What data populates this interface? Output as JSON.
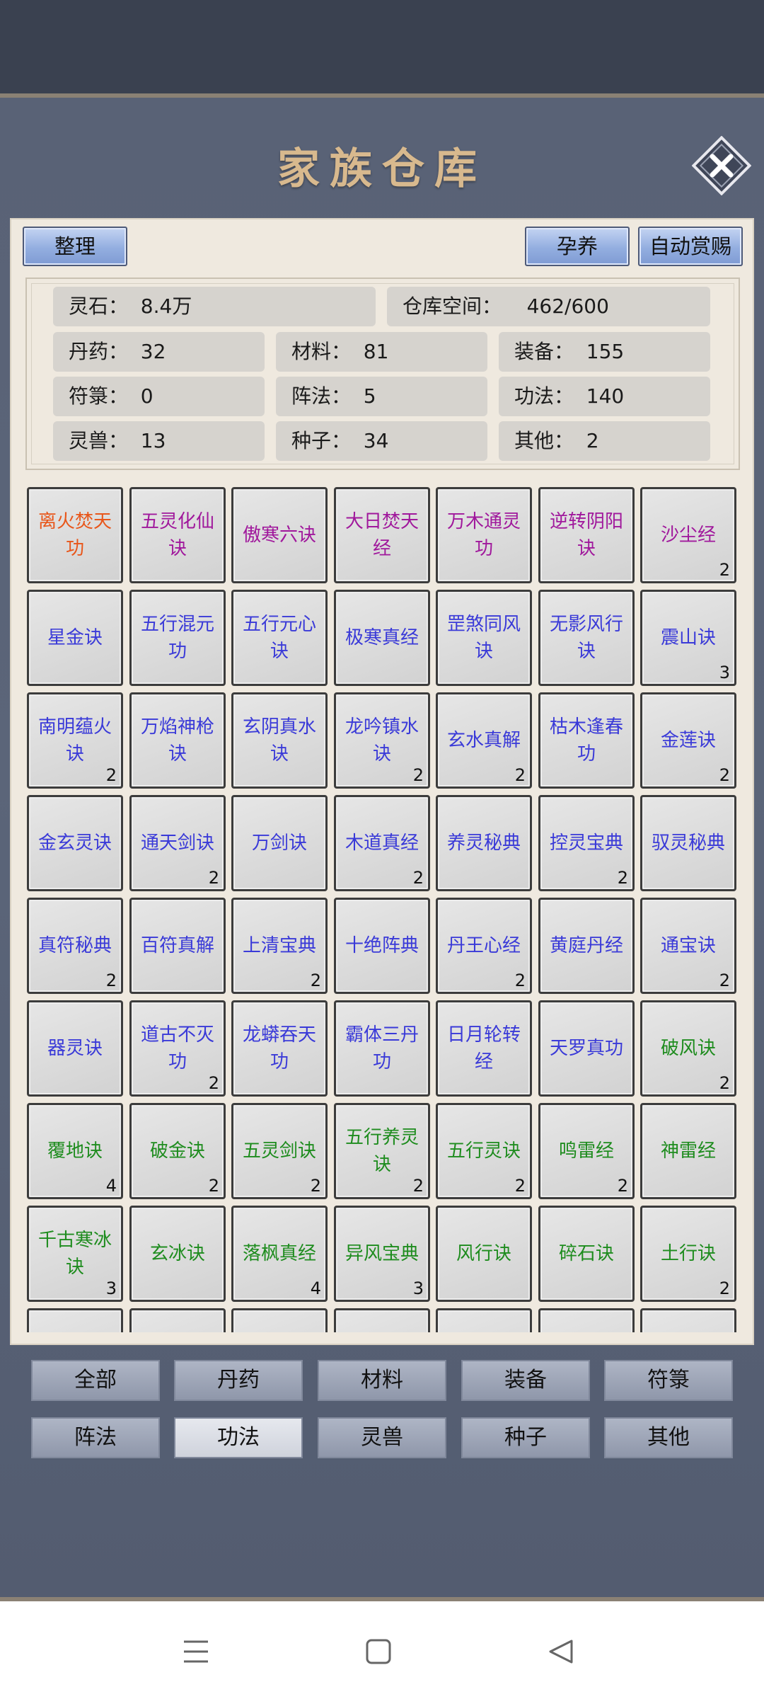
{
  "title": "家族仓库",
  "buttons": {
    "sort": "整理",
    "breed": "孕养",
    "auto_reward": "自动赏赐"
  },
  "stats": {
    "spirit_stone": "灵石：  8.4万",
    "storage_space": "仓库空间：    462/600",
    "pills": "丹药：  32",
    "materials": "材料：  81",
    "equipment": "装备：  155",
    "talismans": "符箓：  0",
    "formations": "阵法：  5",
    "techniques": "功法：  140",
    "beasts": "灵兽：  13",
    "seeds": "种子：  34",
    "others": "其他：  2"
  },
  "colors": {
    "orange": "#e8561a",
    "purple": "#a0189c",
    "blue": "#3a3ad8",
    "green": "#1e8c1e"
  },
  "items": [
    {
      "name": "离火焚天功",
      "color": "orange",
      "count": ""
    },
    {
      "name": "五灵化仙诀",
      "color": "purple",
      "count": ""
    },
    {
      "name": "傲寒六诀",
      "color": "purple",
      "count": ""
    },
    {
      "name": "大日焚天经",
      "color": "purple",
      "count": ""
    },
    {
      "name": "万木通灵功",
      "color": "purple",
      "count": ""
    },
    {
      "name": "逆转阴阳诀",
      "color": "purple",
      "count": ""
    },
    {
      "name": "沙尘经",
      "color": "purple",
      "count": "2"
    },
    {
      "name": "星金诀",
      "color": "blue",
      "count": ""
    },
    {
      "name": "五行混元功",
      "color": "blue",
      "count": ""
    },
    {
      "name": "五行元心诀",
      "color": "blue",
      "count": ""
    },
    {
      "name": "极寒真经",
      "color": "blue",
      "count": ""
    },
    {
      "name": "罡煞同风诀",
      "color": "blue",
      "count": ""
    },
    {
      "name": "无影风行诀",
      "color": "blue",
      "count": ""
    },
    {
      "name": "震山诀",
      "color": "blue",
      "count": "3"
    },
    {
      "name": "南明蕴火诀",
      "color": "blue",
      "count": "2"
    },
    {
      "name": "万焰神枪诀",
      "color": "blue",
      "count": ""
    },
    {
      "name": "玄阴真水诀",
      "color": "blue",
      "count": ""
    },
    {
      "name": "龙吟镇水诀",
      "color": "blue",
      "count": "2"
    },
    {
      "name": "玄水真解",
      "color": "blue",
      "count": "2"
    },
    {
      "name": "枯木逢春功",
      "color": "blue",
      "count": ""
    },
    {
      "name": "金莲诀",
      "color": "blue",
      "count": "2"
    },
    {
      "name": "金玄灵诀",
      "color": "blue",
      "count": ""
    },
    {
      "name": "通天剑诀",
      "color": "blue",
      "count": "2"
    },
    {
      "name": "万剑诀",
      "color": "blue",
      "count": ""
    },
    {
      "name": "木道真经",
      "color": "blue",
      "count": "2"
    },
    {
      "name": "养灵秘典",
      "color": "blue",
      "count": ""
    },
    {
      "name": "控灵宝典",
      "color": "blue",
      "count": "2"
    },
    {
      "name": "驭灵秘典",
      "color": "blue",
      "count": ""
    },
    {
      "name": "真符秘典",
      "color": "blue",
      "count": "2"
    },
    {
      "name": "百符真解",
      "color": "blue",
      "count": ""
    },
    {
      "name": "上清宝典",
      "color": "blue",
      "count": "2"
    },
    {
      "name": "十绝阵典",
      "color": "blue",
      "count": ""
    },
    {
      "name": "丹王心经",
      "color": "blue",
      "count": "2"
    },
    {
      "name": "黄庭丹经",
      "color": "blue",
      "count": ""
    },
    {
      "name": "通宝诀",
      "color": "blue",
      "count": "2"
    },
    {
      "name": "器灵诀",
      "color": "blue",
      "count": ""
    },
    {
      "name": "道古不灭功",
      "color": "blue",
      "count": "2"
    },
    {
      "name": "龙蟒吞天功",
      "color": "blue",
      "count": ""
    },
    {
      "name": "霸体三丹功",
      "color": "blue",
      "count": ""
    },
    {
      "name": "日月轮转经",
      "color": "blue",
      "count": ""
    },
    {
      "name": "天罗真功",
      "color": "blue",
      "count": ""
    },
    {
      "name": "破风诀",
      "color": "green",
      "count": "2"
    },
    {
      "name": "覆地诀",
      "color": "green",
      "count": "4"
    },
    {
      "name": "破金诀",
      "color": "green",
      "count": "2"
    },
    {
      "name": "五灵剑诀",
      "color": "green",
      "count": "2"
    },
    {
      "name": "五行养灵诀",
      "color": "green",
      "count": "2"
    },
    {
      "name": "五行灵诀",
      "color": "green",
      "count": "2"
    },
    {
      "name": "鸣雷经",
      "color": "green",
      "count": "2"
    },
    {
      "name": "神雷经",
      "color": "green",
      "count": ""
    },
    {
      "name": "千古寒冰诀",
      "color": "green",
      "count": "3"
    },
    {
      "name": "玄冰诀",
      "color": "green",
      "count": ""
    },
    {
      "name": "落枫真经",
      "color": "green",
      "count": "4"
    },
    {
      "name": "异风宝典",
      "color": "green",
      "count": "3"
    },
    {
      "name": "风行诀",
      "color": "green",
      "count": ""
    },
    {
      "name": "碎石诀",
      "color": "green",
      "count": ""
    },
    {
      "name": "土行诀",
      "color": "green",
      "count": "2"
    },
    {
      "name": "",
      "color": "green",
      "count": ""
    },
    {
      "name": "",
      "color": "green",
      "count": ""
    },
    {
      "name": "",
      "color": "green",
      "count": ""
    },
    {
      "name": "",
      "color": "green",
      "count": ""
    },
    {
      "name": "",
      "color": "green",
      "count": ""
    },
    {
      "name": "",
      "color": "green",
      "count": ""
    },
    {
      "name": "",
      "color": "green",
      "count": ""
    }
  ],
  "tabs": [
    {
      "label": "全部",
      "active": false
    },
    {
      "label": "丹药",
      "active": false
    },
    {
      "label": "材料",
      "active": false
    },
    {
      "label": "装备",
      "active": false
    },
    {
      "label": "符箓",
      "active": false
    },
    {
      "label": "阵法",
      "active": false
    },
    {
      "label": "功法",
      "active": true
    },
    {
      "label": "灵兽",
      "active": false
    },
    {
      "label": "种子",
      "active": false
    },
    {
      "label": "其他",
      "active": false
    }
  ],
  "nav_icons": [
    "menu-icon",
    "home-icon",
    "back-icon"
  ]
}
